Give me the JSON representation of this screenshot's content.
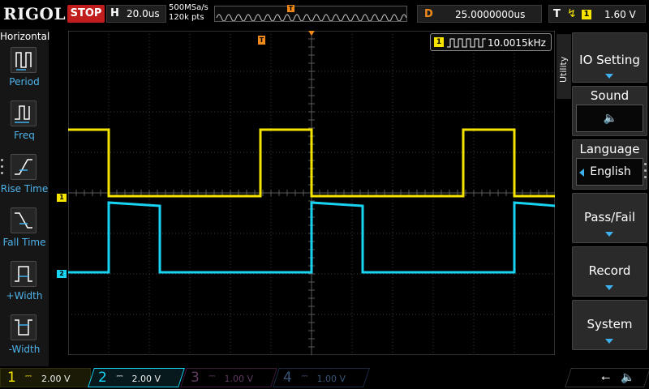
{
  "brand": "RIGOL",
  "run_state": "STOP",
  "timebase": {
    "label": "H",
    "value": "20.0us"
  },
  "sample": {
    "rate": "500MSa/s",
    "points": "120k pts"
  },
  "delay": {
    "label": "D",
    "value": "25.0000000us"
  },
  "trigger": {
    "label": "T",
    "edge_icon": "rising-edge-icon",
    "source": "1",
    "level": "1.60 V"
  },
  "markers": {
    "trigger_pos": "T",
    "trigger_level": "T",
    "ch1": "1",
    "ch2": "2"
  },
  "measurement": {
    "channel": "1",
    "frequency": "10.0015kHz"
  },
  "left_panel": {
    "title": "Horizontal",
    "items": [
      {
        "label": "Period",
        "icon": "period-icon"
      },
      {
        "label": "Freq",
        "icon": "frequency-icon"
      },
      {
        "label": "Rise Time",
        "icon": "rise-time-icon"
      },
      {
        "label": "Fall Time",
        "icon": "fall-time-icon"
      },
      {
        "label": "+Width",
        "icon": "positive-width-icon"
      },
      {
        "label": "-Width",
        "icon": "negative-width-icon"
      }
    ]
  },
  "right_menu": {
    "tab": "Utility",
    "items": [
      {
        "label": "IO Setting"
      },
      {
        "label": "Sound",
        "value_icon": "speaker-icon"
      },
      {
        "label": "Language",
        "value": "English"
      },
      {
        "label": "Pass/Fail"
      },
      {
        "label": "Record"
      },
      {
        "label": "System"
      }
    ]
  },
  "channels": [
    {
      "num": "1",
      "coupling": "DC",
      "scale": "2.00 V",
      "active": true,
      "color": "#f5e400"
    },
    {
      "num": "2",
      "coupling": "DC",
      "scale": "2.00 V",
      "active": true,
      "color": "#16d4f2"
    },
    {
      "num": "3",
      "coupling": "DC",
      "scale": "1.00 V",
      "active": false,
      "color": "#a030a0"
    },
    {
      "num": "4",
      "coupling": "DC",
      "scale": "1.00 V",
      "active": false,
      "color": "#3060b0"
    }
  ],
  "status_icons": [
    "usb-icon",
    "speaker-icon"
  ],
  "colors": {
    "ch1": "#f5e400",
    "ch2": "#16d4f2",
    "trigger": "#f28a1b",
    "menu_accent": "#3fb0ee",
    "stop": "#c21d1d"
  }
}
